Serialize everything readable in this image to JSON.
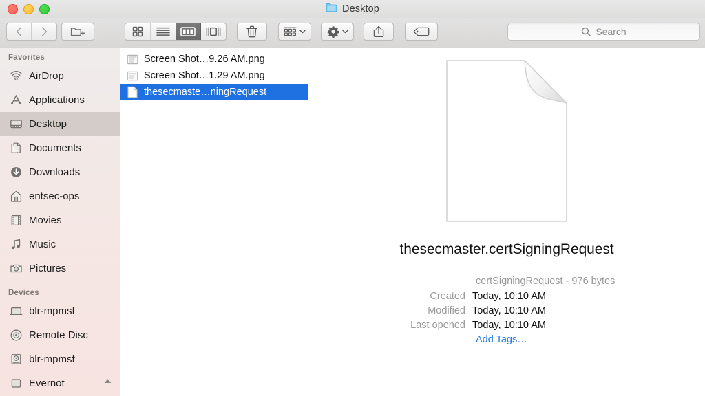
{
  "window": {
    "title": "Desktop",
    "title_icon": "folder-icon",
    "traffic_lights": [
      {
        "name": "close-button",
        "color": "#f65c55"
      },
      {
        "name": "minimize-button",
        "color": "#fdbc33"
      },
      {
        "name": "zoom-button",
        "color": "#30ca33"
      }
    ]
  },
  "toolbar": {
    "back_label": "Back",
    "forward_label": "Forward",
    "new_folder_label": "New Folder",
    "view_modes": [
      {
        "label": "Icon View",
        "icon": "icon-view-icon",
        "active": false
      },
      {
        "label": "List View",
        "icon": "list-view-icon",
        "active": false
      },
      {
        "label": "Column View",
        "icon": "column-view-icon",
        "active": true
      },
      {
        "label": "Gallery View",
        "icon": "gallery-view-icon",
        "active": false
      }
    ],
    "delete_label": "Delete",
    "arrange_label": "Arrange",
    "action_label": "Action",
    "share_label": "Share",
    "tags_label": "Edit Tags"
  },
  "search": {
    "placeholder": "Search",
    "value": "",
    "icon": "search-icon"
  },
  "sidebar": {
    "sections": [
      {
        "header": "Favorites",
        "items": [
          {
            "label": "AirDrop",
            "icon": "airdrop-icon",
            "selected": false
          },
          {
            "label": "Applications",
            "icon": "applications-icon",
            "selected": false
          },
          {
            "label": "Desktop",
            "icon": "desktop-icon",
            "selected": true
          },
          {
            "label": "Documents",
            "icon": "documents-icon",
            "selected": false
          },
          {
            "label": "Downloads",
            "icon": "downloads-icon",
            "selected": false
          },
          {
            "label": "entsec-ops",
            "icon": "home-icon",
            "selected": false
          },
          {
            "label": "Movies",
            "icon": "movies-icon",
            "selected": false
          },
          {
            "label": "Music",
            "icon": "music-icon",
            "selected": false
          },
          {
            "label": "Pictures",
            "icon": "pictures-icon",
            "selected": false
          }
        ]
      },
      {
        "header": "Devices",
        "items": [
          {
            "label": "blr-mpmsf",
            "icon": "laptop-icon",
            "selected": false,
            "eject": false
          },
          {
            "label": "Remote Disc",
            "icon": "optical-disc-icon",
            "selected": false,
            "eject": false
          },
          {
            "label": "blr-mpmsf",
            "icon": "hard-drive-icon",
            "selected": false,
            "eject": false
          },
          {
            "label": "Evernot",
            "icon": "external-drive-icon",
            "selected": false,
            "eject": true
          }
        ]
      }
    ]
  },
  "file_list": {
    "items": [
      {
        "name": "Screen Shot…9.26 AM.png",
        "icon": "png-file-icon",
        "selected": false
      },
      {
        "name": "Screen Shot…1.29 AM.png",
        "icon": "png-file-icon",
        "selected": false
      },
      {
        "name": "thesecmaste…ningRequest",
        "icon": "generic-document-icon",
        "selected": true
      }
    ]
  },
  "preview": {
    "icon": "generic-document-icon",
    "filename": "thesecmaster.certSigningRequest",
    "kind_and_size": "certSigningRequest - 976 bytes",
    "fields": [
      {
        "key": "Created",
        "value": "Today, 10:10 AM"
      },
      {
        "key": "Modified",
        "value": "Today, 10:10 AM"
      },
      {
        "key": "Last opened",
        "value": "Today, 10:10 AM"
      }
    ],
    "add_tags_label": "Add Tags…"
  },
  "colors": {
    "selection_blue": "#1f70e0",
    "link_blue": "#2479e0",
    "sidebar_tint": "#f6e6e3"
  }
}
